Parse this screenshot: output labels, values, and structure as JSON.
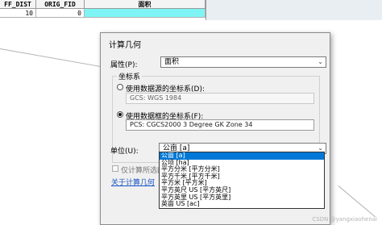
{
  "table": {
    "columns": [
      "FF_DIST",
      "ORIG_FID",
      "面积"
    ],
    "row": [
      "10",
      "0",
      ""
    ]
  },
  "dialog": {
    "title": "计算几何",
    "property_label": "属性(P):",
    "property_value": "面积",
    "group_title": "坐标系",
    "radio_source_label": "使用数据源的坐标系(D):",
    "source_cs": "GCS: WGS 1984",
    "radio_frame_label": "使用数据框的坐标系(F):",
    "frame_cs": "PCS: CGCS2000 3 Degree GK Zone 34",
    "unit_label": "单位(U):",
    "unit_value": "公亩 [a]",
    "selected_only_label": "仅计算所选的记录(R)",
    "about_link": "关于计算几何"
  },
  "unit_options": [
    "公亩 [a]",
    "公顷 [ha]",
    "平方分米 [平方分米]",
    "平方千米 [平方千米]",
    "平方米 [平方米]",
    "平方英尺 US [平方英尺]",
    "平方英里 US [平方英里]",
    "英亩 US [ac]"
  ],
  "watermark": "CSDN @yangxiaohenai"
}
